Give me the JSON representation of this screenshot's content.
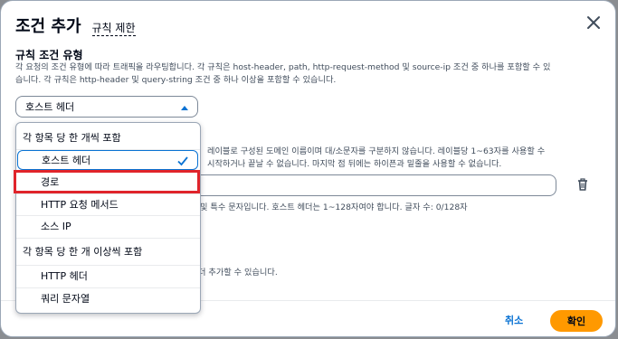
{
  "modal": {
    "title": "조건 추가",
    "info_link": "규칙 제한",
    "field_label": "규칙 조건 유형",
    "description_line1": "각 요청의 조건 유형에 따라 트래픽을 라우팅합니다. 각 규칙은 host-header, path, http-request-method 및 source-ip 조건 중 하나를 포함할 수 있",
    "description_line2": "습니다. 각 규칙은 http-header 및 query-string 조건 중 하나 이상을 포함할 수 있습니다.",
    "select_value": "호스트 헤더"
  },
  "background": {
    "hint_line1": "레이블로 구성된 도메인 이름이며 대/소문자를 구분하지 않습니다. 레이블당 1~63자를 사용할 수",
    "hint_line2": "시작하거나 끝날 수 없습니다. 마지막 점 뒤에는 하이픈과 밑줄을 사용할 수 없습니다.",
    "value_hint": "및 특수 문자입니다. 호스트 헤더는 1~128자여야 합니다. 글자 수: 0/128자",
    "add_hint": "더 추가할 수 있습니다."
  },
  "dropdown": {
    "group1_label": "각 항목 당 한 개씩 포함",
    "group1_options": [
      "호스트 헤더",
      "경로",
      "HTTP 요청 메서드",
      "소스 IP"
    ],
    "group2_label": "각 항목 당 한 개 이상씩 포함",
    "group2_options": [
      "HTTP 헤더",
      "쿼리 문자열"
    ]
  },
  "footer": {
    "cancel_label": "취소",
    "confirm_label": "확인"
  },
  "colors": {
    "accent": "#0972d3",
    "primary_button": "#ff9900",
    "highlight": "#e0242b"
  },
  "icons": [
    "close-icon",
    "caret-up-icon",
    "check-icon",
    "trash-icon"
  ]
}
